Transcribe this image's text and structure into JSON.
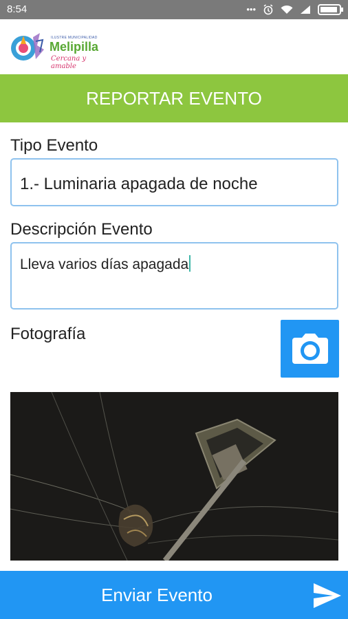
{
  "status_bar": {
    "time": "8:54",
    "icons": [
      "more-dots-icon",
      "alarm-icon",
      "wifi-icon",
      "signal-icon",
      "battery-icon"
    ],
    "battery_level": 0.8
  },
  "logo": {
    "small_text": "ILUSTRE MUNICIPALIDAD",
    "name": "Melipilla",
    "tagline": "Cercana y amable"
  },
  "header": {
    "title": "REPORTAR EVENTO"
  },
  "form": {
    "tipo_label": "Tipo Evento",
    "tipo_value": "1.- Luminaria apagada de noche",
    "descripcion_label": "Descripción Evento",
    "descripcion_value": "Lleva varios días apagada",
    "foto_label": "Fotografía"
  },
  "footer": {
    "send_label": "Enviar Evento"
  },
  "colors": {
    "header_green": "#8dc63f",
    "accent_blue": "#2196f3",
    "field_border": "#8ec2ee"
  }
}
